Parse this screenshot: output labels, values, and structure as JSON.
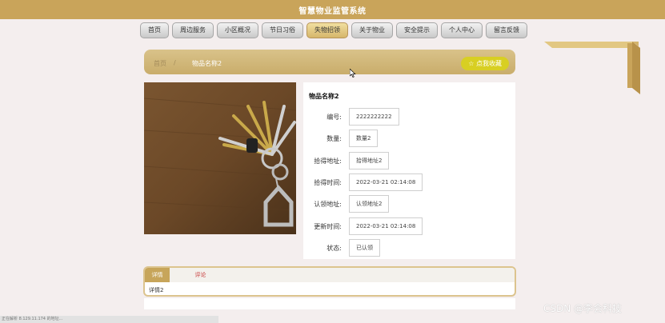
{
  "header": {
    "title": "智慧物业监管系统"
  },
  "nav": {
    "items": [
      {
        "label": "首页"
      },
      {
        "label": "周边服务"
      },
      {
        "label": "小区概况"
      },
      {
        "label": "节日习俗"
      },
      {
        "label": "失物招领"
      },
      {
        "label": "关于物业"
      },
      {
        "label": "安全提示"
      },
      {
        "label": "个人中心"
      },
      {
        "label": "留言反馈"
      }
    ],
    "active_index": 4
  },
  "breadcrumb": {
    "home": "首页",
    "separator": "/",
    "current": "物品名称2"
  },
  "favorite": {
    "label": "☆ 点我收藏"
  },
  "item": {
    "name": "物品名称2",
    "fields": [
      {
        "label": "编号:",
        "value": "2222222222"
      },
      {
        "label": "数量:",
        "value": "数量2"
      },
      {
        "label": "拾得地址:",
        "value": "拾得地址2"
      },
      {
        "label": "拾得时间:",
        "value": "2022-03-21 02:14:08"
      },
      {
        "label": "认领地址:",
        "value": "认领地址2"
      },
      {
        "label": "更新时间:",
        "value": "2022-03-21 02:14:08"
      },
      {
        "label": "状态:",
        "value": "已认领"
      }
    ]
  },
  "tabs": {
    "items": [
      {
        "label": "详情"
      },
      {
        "label": "评论"
      }
    ],
    "content": "详情2"
  },
  "status_bar": {
    "text": "正在解析 8.129.11.174 的地址..."
  },
  "watermark": {
    "text": "CSDN @李会科技"
  },
  "colors": {
    "banner": "#c9a45a",
    "accent_gold": "#c7a55a",
    "favorite_button": "#d8cf22",
    "page_bg": "#f4eeee"
  }
}
